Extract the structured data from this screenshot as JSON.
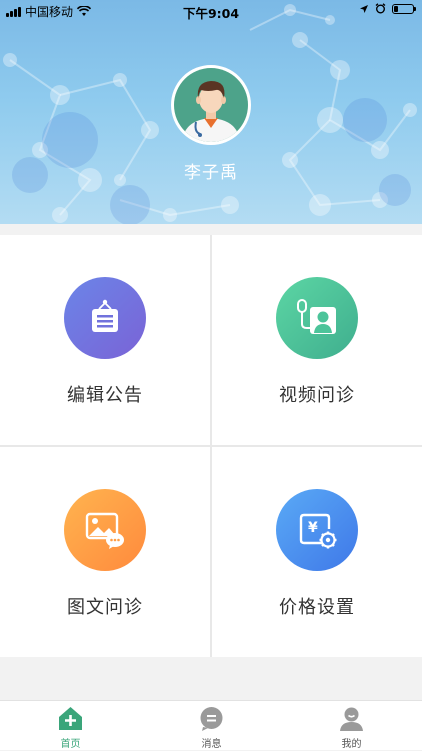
{
  "status_bar": {
    "carrier": "中国移动",
    "time": "下午9:04"
  },
  "profile": {
    "name": "李子禹",
    "avatar_icon": "doctor-avatar"
  },
  "menu": {
    "items": [
      {
        "label": "编辑公告",
        "icon": "notice-board-icon",
        "color": "#7172dc"
      },
      {
        "label": "视频问诊",
        "icon": "video-consult-icon",
        "color": "#4cc49a"
      },
      {
        "label": "图文问诊",
        "icon": "image-text-consult-icon",
        "color": "#ff9e45"
      },
      {
        "label": "价格设置",
        "icon": "price-settings-icon",
        "color": "#4a8ff0"
      }
    ]
  },
  "tabbar": {
    "tabs": [
      {
        "label": "首页",
        "icon": "home-plus-icon",
        "active": true
      },
      {
        "label": "消息",
        "icon": "message-bubble-icon",
        "active": false
      },
      {
        "label": "我的",
        "icon": "user-profile-icon",
        "active": false
      }
    ],
    "accent_color": "#3aa57a"
  }
}
